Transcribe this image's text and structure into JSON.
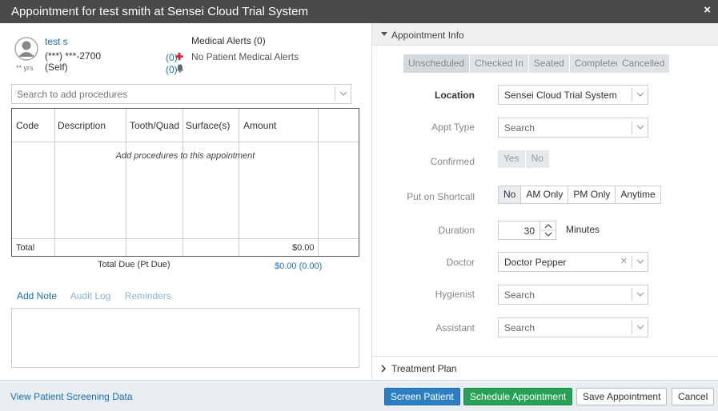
{
  "window": {
    "title": "Appointment for test smith at Sensei Cloud Trial System",
    "close_glyph": "×"
  },
  "patient": {
    "name": "test s",
    "phone": "(***) ***-2700",
    "relation": "(Self)",
    "age": "** yrs",
    "medical_alert_count": "(0)",
    "reminder_count": "(0)",
    "medical_alerts_title": "Medical Alerts (0)",
    "medical_alerts_text": "No Patient Medical Alerts"
  },
  "procedures": {
    "search_placeholder": "Search to add procedures",
    "columns": [
      "Code",
      "Description",
      "Tooth/Quad",
      "Surface(s)",
      "Amount"
    ],
    "empty_text": "Add procedures to this appointment",
    "total_label": "Total",
    "total_value": "$0.00",
    "total_due_label": "Total Due (Pt Due)",
    "total_due_value": "$0.00 (0.00)"
  },
  "notes": {
    "tabs": [
      "Add Note",
      "Audit Log",
      "Reminders"
    ]
  },
  "appointment_info": {
    "header": "Appointment Info",
    "statuses": [
      "Unscheduled",
      "Checked In",
      "Seated",
      "Completed"
    ],
    "cancelled": "Cancelled",
    "location_label": "Location",
    "location_value": "Sensei Cloud Trial System",
    "appt_type_label": "Appt Type",
    "appt_type_placeholder": "Search",
    "confirmed_label": "Confirmed",
    "confirmed_options": [
      "Yes",
      "No"
    ],
    "shortcall_label": "Put on Shortcall",
    "shortcall_options": [
      "No",
      "AM Only",
      "PM Only",
      "Anytime"
    ],
    "shortcall_selected": "No",
    "duration_label": "Duration",
    "duration_value": "30",
    "duration_unit": "Minutes",
    "doctor_label": "Doctor",
    "doctor_value": "Doctor Pepper",
    "hygienist_label": "Hygienist",
    "hygienist_placeholder": "Search",
    "assistant_label": "Assistant",
    "assistant_placeholder": "Search"
  },
  "treatment_plan": {
    "label": "Treatment Plan"
  },
  "footer": {
    "screening_link": "View Patient Screening Data",
    "screen_patient": "Screen Patient",
    "schedule": "Schedule Appointment",
    "save": "Save Appointment",
    "cancel": "Cancel"
  },
  "colors": {
    "titlebar": "#4a4a4a",
    "link": "#1a6fb5",
    "primary_button": "#2d7fc4",
    "success_button": "#27a155",
    "alert_red": "#d9232a"
  },
  "icons": [
    "user-avatar-icon",
    "medical-cross-icon",
    "bell-icon",
    "chevron-down-icon",
    "chevron-right-icon",
    "close-icon",
    "spinner-arrows-icon"
  ]
}
